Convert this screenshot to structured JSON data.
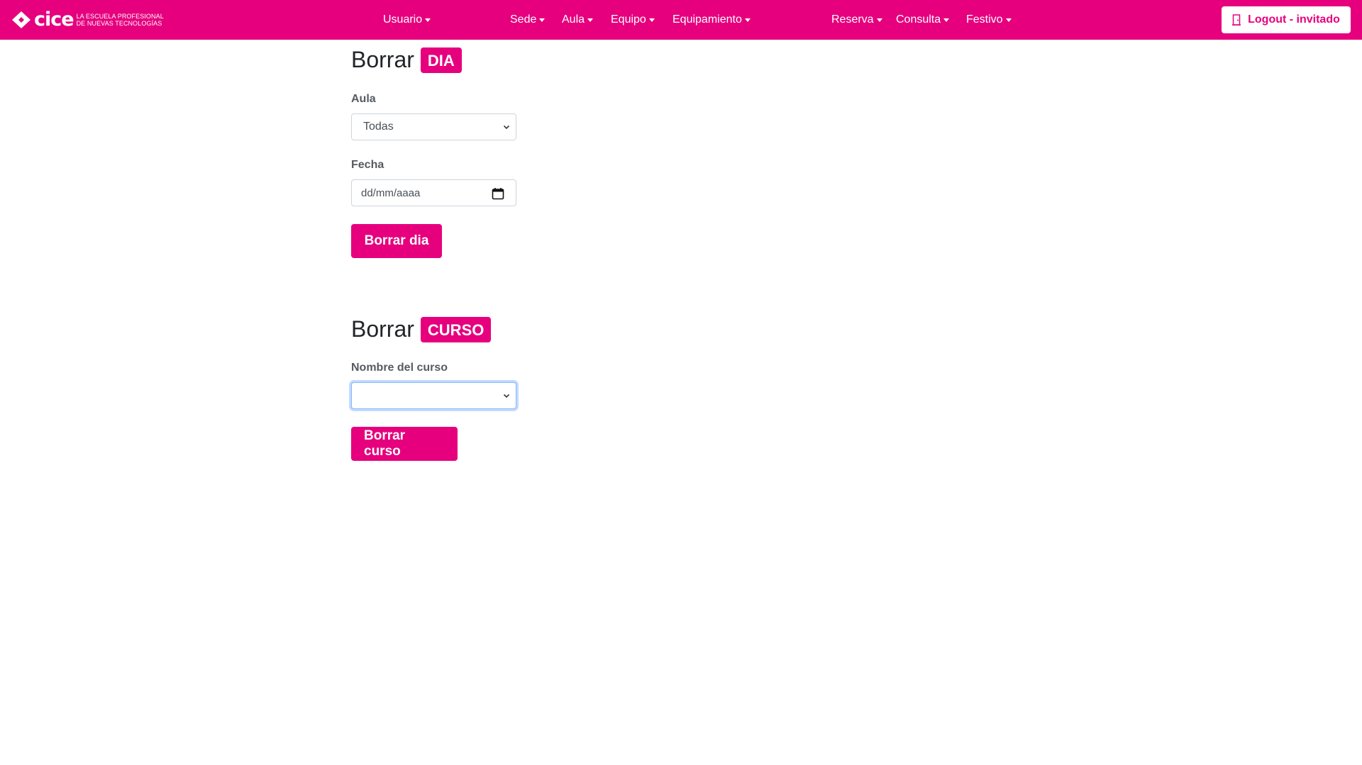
{
  "brand": {
    "word": "cice",
    "tagline_line1": "La escuela profesional",
    "tagline_line2": "de nuevas tecnologías",
    "icon": "cice-logo-icon"
  },
  "nav": {
    "items": [
      {
        "label": "Usuario"
      },
      {
        "label": "Sede"
      },
      {
        "label": "Aula"
      },
      {
        "label": "Equipo"
      },
      {
        "label": "Equipamiento"
      },
      {
        "label": "Reserva"
      },
      {
        "label": "Consulta"
      },
      {
        "label": "Festivo"
      }
    ],
    "logout_label": "Logout - invitado",
    "logout_icon": "door-icon"
  },
  "colors": {
    "brand": "#e6007e",
    "text": "#212529",
    "label": "#555b61",
    "focus": "#86b7fe"
  },
  "borrar_dia": {
    "title": "Borrar",
    "badge": "DIA",
    "aula_label": "Aula",
    "aula_selected": "Todas",
    "fecha_label": "Fecha",
    "fecha_placeholder": "dd/mm/aaaa",
    "button_label": "Borrar dia"
  },
  "borrar_curso": {
    "title": "Borrar",
    "badge": "CURSO",
    "nombre_label": "Nombre del curso",
    "nombre_selected": "",
    "button_label": "Borrar curso"
  }
}
